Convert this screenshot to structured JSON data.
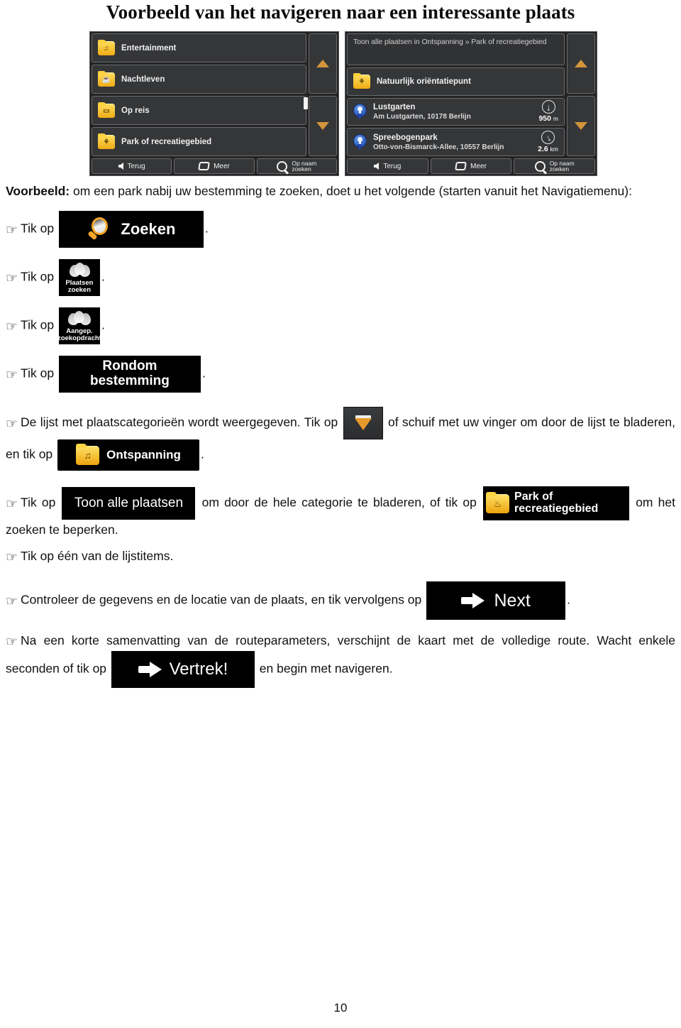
{
  "document": {
    "title": "Voorbeeld van het navigeren naar een interessante plaats",
    "page_number": "10"
  },
  "screens": {
    "left": {
      "name": "plaatscategorieen-lijst",
      "rows": [
        {
          "label": "Entertainment",
          "icon": "folder-entertainment-icon",
          "glyph": "♫"
        },
        {
          "label": "Nachtleven",
          "icon": "folder-nightlife-icon",
          "glyph": "☕"
        },
        {
          "label": "Op reis",
          "icon": "folder-travel-icon",
          "glyph": "▭"
        },
        {
          "label": "Park of recreatiegebied",
          "icon": "folder-park-icon",
          "glyph": "⚘"
        }
      ],
      "bottom_bar": [
        {
          "label": "Terug",
          "icon": "arrow-left-icon"
        },
        {
          "label": "Meer",
          "icon": "more-icon"
        },
        {
          "label": "Op naam\nzoeken",
          "icon": "magnifier-icon"
        }
      ],
      "scroll": {
        "up": "scroll-up-arrow",
        "down": "scroll-down-arrow"
      }
    },
    "right": {
      "name": "plaatsenlijst-resultaten",
      "header": "Toon alle plaatsen in Ontspanning » Park of recreatiegebied",
      "category_row": {
        "label": "Natuurlijk oriëntatiepunt",
        "icon": "folder-nature-icon",
        "glyph": "⚘"
      },
      "results": [
        {
          "name": "Lustgarten",
          "address": "Am Lustgarten, 10178 Berlijn",
          "distance": "950",
          "unit": "m",
          "direction_deg": 0
        },
        {
          "name": "Spreebogenpark",
          "address": "Otto-von-Bismarck-Allee, 10557 Berlijn",
          "distance": "2.6",
          "unit": "km",
          "direction_deg": -25
        }
      ],
      "bottom_bar": [
        {
          "label": "Terug",
          "icon": "arrow-left-icon"
        },
        {
          "label": "Meer",
          "icon": "more-icon"
        },
        {
          "label": "Op naam\nzoeken",
          "icon": "magnifier-icon"
        }
      ],
      "scroll": {
        "up": "scroll-up-arrow",
        "down": "scroll-down-arrow"
      }
    }
  },
  "body": {
    "intro_bold": "Voorbeeld:",
    "intro_rest": " om een park nabij uw bestemming te zoeken, doet u het volgende (starten vanuit het Navigatiemenu):",
    "step_prefix": "Tik op",
    "period": ".",
    "steps": {
      "zoeken": {
        "prefix": "Tik op",
        "badge": "Zoeken",
        "suffix": "."
      },
      "plaatsen_zoeken": {
        "prefix": "Tik op",
        "badge": "Plaatsen\nzoeken",
        "suffix": "."
      },
      "aangepaste_zoekopdracht": {
        "prefix": "Tik op",
        "badge": "Aangep.\nzoekopdracht",
        "suffix": "."
      },
      "rondom_bestemming": {
        "prefix": "Tik op",
        "badge": "Rondom\nbestemming",
        "suffix": "."
      }
    },
    "list_step": {
      "part1": "De lijst met plaatscategorieën wordt weergegeven. Tik op",
      "part2": "of schuif met uw vinger om door de lijst te bladeren, en tik op",
      "badge_category": "Ontspanning",
      "suffix": "."
    },
    "browse_step": {
      "part1": "Tik op",
      "badge_all": "Toon alle plaatsen",
      "part2": "om door de hele categorie te bladeren, of tik op",
      "badge_park": "Park of\nrecreatiegebied",
      "part3": "om het zoeken te beperken."
    },
    "tap_item": "Tik op één van de lijstitems.",
    "check_step": {
      "part1": "Controleer de gegevens en de locatie van de plaats, en tik vervolgens op",
      "badge_next": "Next",
      "part2": "."
    },
    "summary_step": {
      "part1": "Na een korte samenvatting van de routeparameters, verschijnt de kaart met de volledige route. Wacht enkele seconden of tik op",
      "badge_go": "Vertrek!",
      "part2": "en begin met navigeren."
    }
  },
  "colors": {
    "accent_orange": "#d4943b",
    "folder_yellow": "#f0ab15",
    "pin_blue": "#1d46a8",
    "screen_bg": "#232323",
    "row_bg": "#353638",
    "badge_black": "#000000"
  }
}
